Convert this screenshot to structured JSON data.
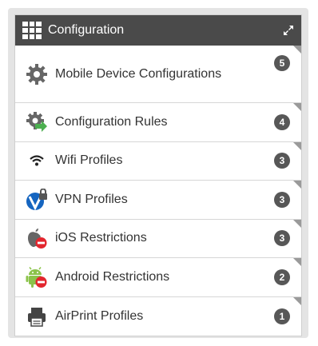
{
  "widget": {
    "title": "Configuration",
    "title_icon": "grid-icon",
    "expand_icon": "expand-icon"
  },
  "items": [
    {
      "label": "Mobile Device Configurations",
      "count": "5",
      "icon": "gear-icon"
    },
    {
      "label": "Configuration Rules",
      "count": "4",
      "icon": "gear-rules-icon"
    },
    {
      "label": "Wifi Profiles",
      "count": "3",
      "icon": "wifi-icon"
    },
    {
      "label": "VPN Profiles",
      "count": "3",
      "icon": "vpn-icon"
    },
    {
      "label": "iOS Restrictions",
      "count": "3",
      "icon": "apple-restricted-icon"
    },
    {
      "label": "Android Restrictions",
      "count": "2",
      "icon": "android-restricted-icon"
    },
    {
      "label": "AirPrint Profiles",
      "count": "1",
      "icon": "printer-icon"
    }
  ],
  "colors": {
    "header_bg": "#4a4a4a",
    "badge_bg": "#575757",
    "restricted_red": "#e3262e",
    "rules_green": "#4caf50",
    "vpn_blue": "#1565c0"
  }
}
